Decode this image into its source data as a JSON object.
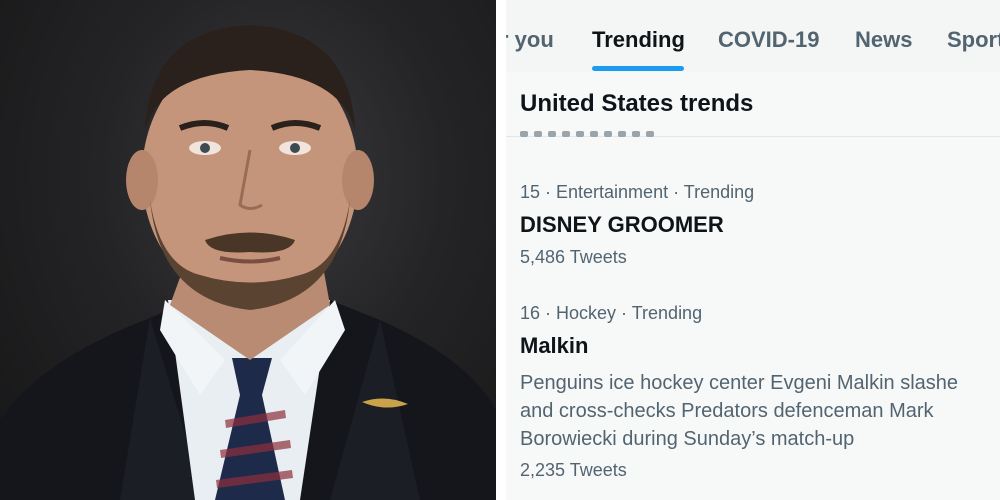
{
  "tabs": [
    {
      "label": "r you",
      "active": false
    },
    {
      "label": "Trending",
      "active": true
    },
    {
      "label": "COVID-19",
      "active": false
    },
    {
      "label": "News",
      "active": false
    },
    {
      "label": "Sport",
      "active": false
    }
  ],
  "section": {
    "title": "United States trends"
  },
  "trends": [
    {
      "rank": "15",
      "category": "Entertainment",
      "status": "Trending",
      "meta": "15 · Entertainment · Trending",
      "name": "DISNEY GROOMER",
      "description": "",
      "tweets": "5,486 Tweets"
    },
    {
      "rank": "16",
      "category": "Hockey",
      "status": "Trending",
      "meta": "16 · Hockey · Trending",
      "name": "Malkin",
      "description": "Penguins ice hockey center Evgeni Malkin slashe\nand cross-checks Predators defenceman Mark\nBorowiecki during Sunday’s match-up",
      "tweets": "2,235 Tweets"
    }
  ],
  "colors": {
    "accent": "#1d9bf0",
    "text_primary": "#0f1419",
    "text_secondary": "#536471",
    "photo_background": "#242426"
  }
}
